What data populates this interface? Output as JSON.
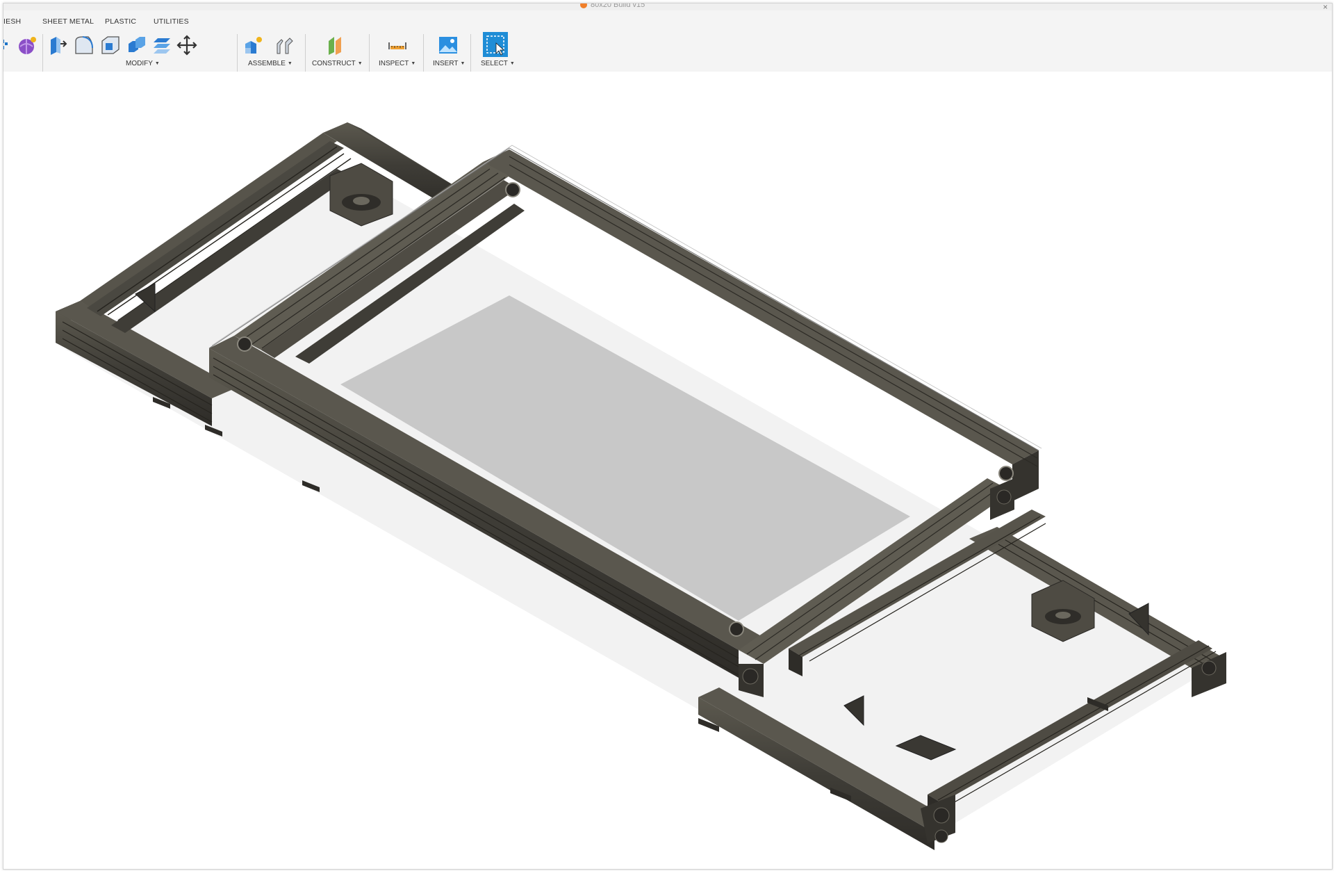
{
  "window": {
    "title": "80x20 Build v15"
  },
  "toolbar": {
    "tabs": [
      {
        "label": "MESH",
        "visible_text": "IESH"
      },
      {
        "label": "SHEET METAL"
      },
      {
        "label": "PLASTIC"
      },
      {
        "label": "UTILITIES"
      }
    ],
    "groups": [
      {
        "label": "MODIFY",
        "has_dropdown": true
      },
      {
        "label": "ASSEMBLE",
        "has_dropdown": true
      },
      {
        "label": "CONSTRUCT",
        "has_dropdown": true
      },
      {
        "label": "INSPECT",
        "has_dropdown": true
      },
      {
        "label": "INSERT",
        "has_dropdown": true
      },
      {
        "label": "SELECT",
        "has_dropdown": true
      }
    ],
    "tools": [
      {
        "icon": "create-form-icon",
        "group": "create"
      },
      {
        "icon": "press-pull-icon",
        "group": "MODIFY"
      },
      {
        "icon": "fillet-icon",
        "group": "MODIFY"
      },
      {
        "icon": "shell-icon",
        "group": "MODIFY"
      },
      {
        "icon": "combine-icon",
        "group": "MODIFY"
      },
      {
        "icon": "offset-face-icon",
        "group": "MODIFY"
      },
      {
        "icon": "move-icon",
        "group": "MODIFY"
      },
      {
        "icon": "new-component-icon",
        "group": "ASSEMBLE"
      },
      {
        "icon": "joint-icon",
        "group": "ASSEMBLE"
      },
      {
        "icon": "offset-plane-icon",
        "group": "CONSTRUCT"
      },
      {
        "icon": "measure-icon",
        "group": "INSPECT"
      },
      {
        "icon": "insert-image-icon",
        "group": "INSERT"
      },
      {
        "icon": "select-icon",
        "group": "SELECT",
        "active": true
      }
    ]
  },
  "viewport": {
    "model": "aluminum extrusion frame assembly with clear panel",
    "colors": {
      "extrusion": "#3f3d37",
      "extrusion_highlight": "#5a574e",
      "panel": "#c8c8c8",
      "select_blue": "#1f8dd6"
    }
  }
}
